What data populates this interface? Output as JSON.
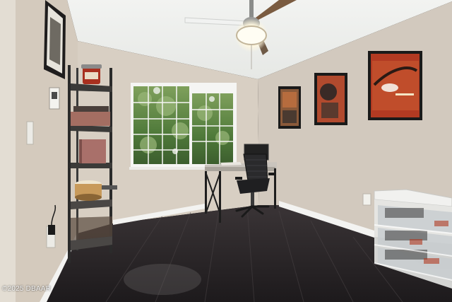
{
  "watermark": "©2025 DBAAR",
  "colors": {
    "ceiling": "#eef0ee",
    "wall_left": "#d6ccc0",
    "wall_back": "#d9d0c5",
    "wall_right": "#d3cac0",
    "floor": "#2a2628",
    "baseboard": "#f4f4f2",
    "window_greenery": "#5f7f45",
    "shelf_metal": "#2b2b2b",
    "poster_red": "#b23a22"
  }
}
